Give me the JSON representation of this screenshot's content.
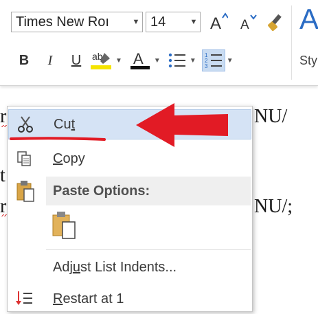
{
  "toolbar": {
    "font_name": "Times New Roı",
    "font_size": "14",
    "styles_label": "Sty"
  },
  "document": {
    "line1_suffix": "NU/",
    "line2_suffix": "NU/;"
  },
  "context_menu": {
    "cut": {
      "label_pre": "Cu",
      "label_ul": "t",
      "label_post": ""
    },
    "copy": {
      "label_pre": "",
      "label_ul": "C",
      "label_post": "opy"
    },
    "paste_options": {
      "label": "Paste Options:"
    },
    "adjust_indents": {
      "label_pre": "Adj",
      "label_ul": "u",
      "label_post": "st List Indents..."
    },
    "restart": {
      "label_pre": "",
      "label_ul": "R",
      "label_post": "estart at 1"
    }
  },
  "colors": {
    "highlight": "#d5e3f5",
    "annotation_red": "#e21b25",
    "styles_blue": "#2b6cc4",
    "highlighter_yellow": "#f5e400",
    "font_color_red": "#e21b25"
  }
}
